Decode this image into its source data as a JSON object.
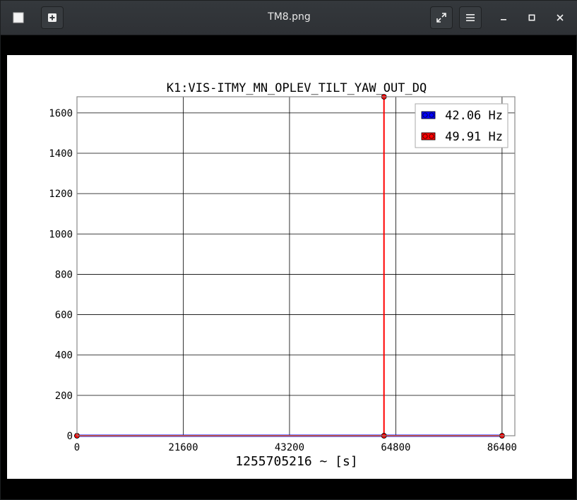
{
  "window": {
    "title": "TM8.png",
    "icons": {
      "app": "app-icon",
      "new_tab": "new-tab-icon",
      "fullscreen": "expand-icon",
      "menu": "hamburger-menu-icon",
      "minimize": "minimize-icon",
      "maximize": "maximize-icon",
      "close": "close-icon"
    }
  },
  "chart_data": {
    "type": "line",
    "title": "K1:VIS-ITMY_MN_OPLEV_TILT_YAW_OUT_DQ",
    "xlabel": "1255705216 ~ [s]",
    "ylabel": "",
    "xlim": [
      0,
      89000
    ],
    "ylim": [
      0,
      1680
    ],
    "x_ticks": [
      0,
      21600,
      43200,
      64800,
      86400
    ],
    "x_tick_labels": [
      "0",
      "21600",
      "43200",
      "64800",
      "86400"
    ],
    "y_ticks": [
      0,
      200,
      400,
      600,
      800,
      1000,
      1200,
      1400,
      1600
    ],
    "y_tick_labels": [
      "0",
      "200",
      "400",
      "600",
      "800",
      "1000",
      "1200",
      "1400",
      "1600"
    ],
    "grid": true,
    "legend_position": "top-right",
    "series": [
      {
        "name": "42.06 Hz",
        "color": "#0000ff",
        "x": [
          0,
          86400
        ],
        "y": [
          0,
          0
        ]
      },
      {
        "name": "49.91 Hz",
        "color": "#ff0000",
        "x": [
          0,
          62400,
          62400,
          62400,
          86400
        ],
        "y": [
          0,
          0,
          1680,
          0,
          0
        ]
      }
    ]
  }
}
